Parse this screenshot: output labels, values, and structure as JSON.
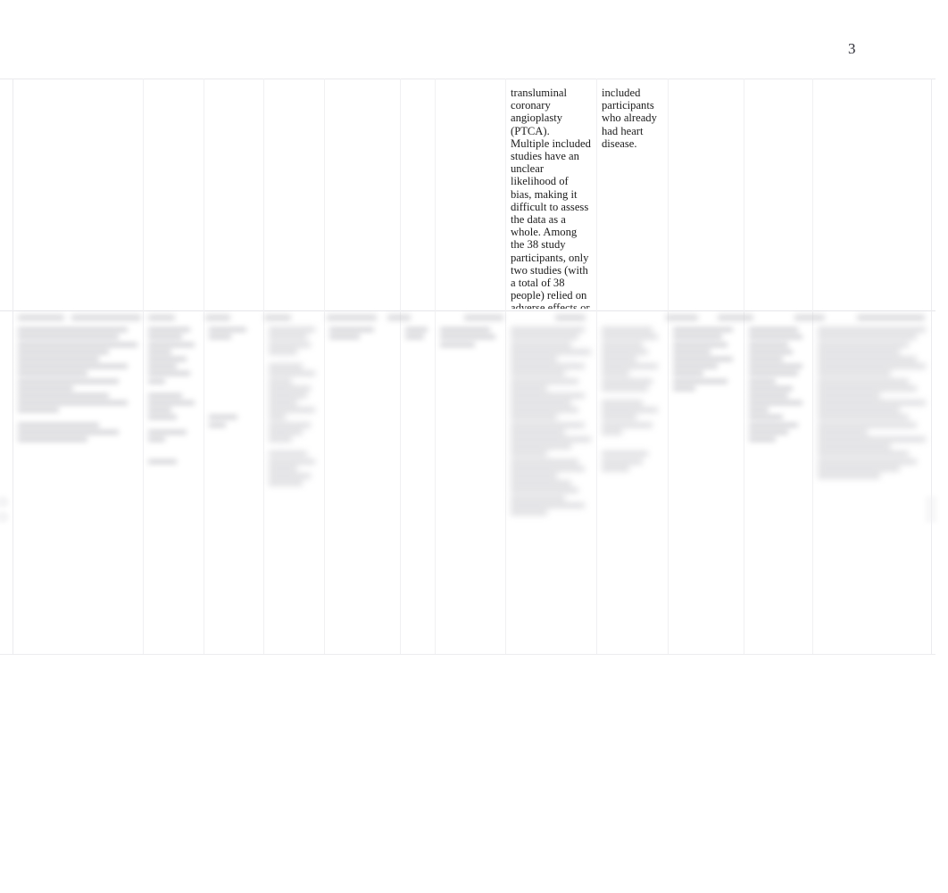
{
  "document": {
    "page_number": "3",
    "background_color": "#ffffff",
    "text_color": "#1b1b1b",
    "rule_color": "#ebebee"
  },
  "table": {
    "row_top": {
      "cells": [
        {
          "id": "c1",
          "state": "blank",
          "text": ""
        },
        {
          "id": "c2",
          "state": "blank",
          "text": ""
        },
        {
          "id": "c3",
          "state": "blank",
          "text": ""
        },
        {
          "id": "c4",
          "state": "blank",
          "text": ""
        },
        {
          "id": "c5",
          "state": "blank",
          "text": ""
        },
        {
          "id": "c6",
          "state": "blank",
          "text": ""
        },
        {
          "id": "c7",
          "state": "blank",
          "text": ""
        },
        {
          "id": "c8",
          "state": "legible",
          "text": "transluminal coronary angioplasty (PTCA). Multiple included studies have an unclear likelihood of bias, making it difficult to assess the data as a whole. Among the 38 study participants, only two studies (with a total of 38 people) relied on adverse effects or risks (low-quality data)."
        },
        {
          "id": "c9",
          "state": "legible",
          "text": "included participants who already had heart disease."
        },
        {
          "id": "c10",
          "state": "blank",
          "text": ""
        },
        {
          "id": "c11",
          "state": "blank",
          "text": ""
        },
        {
          "id": "c12",
          "state": "blank",
          "text": ""
        },
        {
          "id": "c13",
          "state": "blank",
          "text": ""
        }
      ]
    },
    "row_bottom": {
      "note": "All cells in this row are blurred beyond legibility in the source image.",
      "cells": [
        {
          "id": "d1",
          "state": "redacted",
          "density": "medium"
        },
        {
          "id": "d2",
          "state": "redacted",
          "density": "medium"
        },
        {
          "id": "d3",
          "state": "redacted",
          "density": "light"
        },
        {
          "id": "d4",
          "state": "redacted",
          "density": "heavy"
        },
        {
          "id": "d5",
          "state": "redacted",
          "density": "light"
        },
        {
          "id": "d6",
          "state": "redacted",
          "density": "light"
        },
        {
          "id": "d7",
          "state": "redacted",
          "density": "light"
        },
        {
          "id": "d8",
          "state": "redacted",
          "density": "heavy"
        },
        {
          "id": "d9",
          "state": "redacted",
          "density": "heavy"
        },
        {
          "id": "d10",
          "state": "redacted",
          "density": "medium"
        },
        {
          "id": "d11",
          "state": "redacted",
          "density": "medium"
        },
        {
          "id": "d12",
          "state": "redacted",
          "density": "light"
        },
        {
          "id": "d13",
          "state": "redacted",
          "density": "heavy"
        }
      ]
    }
  }
}
